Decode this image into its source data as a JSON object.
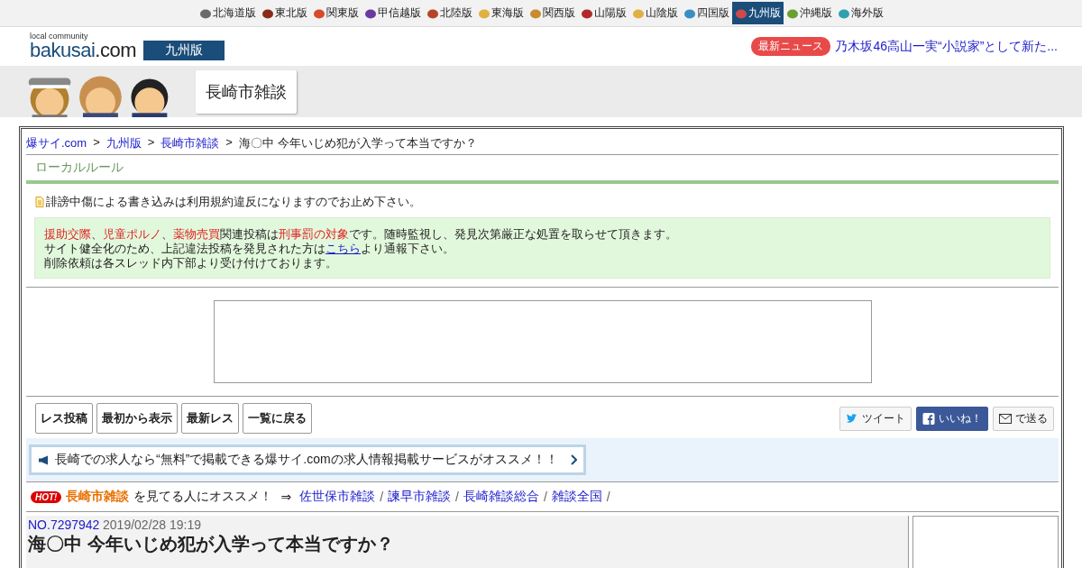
{
  "regions": [
    {
      "label": "北海道版",
      "selected": false,
      "color": "#6a6a6a"
    },
    {
      "label": "東北版",
      "selected": false,
      "color": "#8a2b1a"
    },
    {
      "label": "関東版",
      "selected": false,
      "color": "#d94a2a"
    },
    {
      "label": "甲信越版",
      "selected": false,
      "color": "#6b3aa0"
    },
    {
      "label": "北陸版",
      "selected": false,
      "color": "#b5452a"
    },
    {
      "label": "東海版",
      "selected": false,
      "color": "#e0b040"
    },
    {
      "label": "関西版",
      "selected": false,
      "color": "#c98a30"
    },
    {
      "label": "山陽版",
      "selected": false,
      "color": "#b02a2a"
    },
    {
      "label": "山陰版",
      "selected": false,
      "color": "#e0b040"
    },
    {
      "label": "四国版",
      "selected": false,
      "color": "#3a8fc0"
    },
    {
      "label": "九州版",
      "selected": true,
      "color": "#d04a4a"
    },
    {
      "label": "沖縄版",
      "selected": false,
      "color": "#6aa030"
    },
    {
      "label": "海外版",
      "selected": false,
      "color": "#30a0b0"
    }
  ],
  "header": {
    "logo_tagline": "local community",
    "logo": "bakusai",
    "logo_suffix": ".com",
    "edition": "九州版",
    "news_badge": "最新ニュース",
    "news_headline": "乃木坂46高山一実“小説家”として新た..."
  },
  "board_title": "長崎市雑談",
  "breadcrumb_separator": ">",
  "link_separator": "/",
  "breadcrumbs": [
    {
      "label": "爆サイ.com",
      "kind": "link"
    },
    {
      "label": "九州版",
      "kind": "link"
    },
    {
      "label": "長崎市雑談",
      "kind": "link"
    },
    {
      "label": "海〇中 今年いじめ犯が入学って本当ですか？",
      "kind": "text"
    }
  ],
  "local_rules": {
    "heading": "ローカルルール",
    "rule": "誹謗中傷による書き込みは利用規約違反になりますのでお止め下さい。",
    "notice_lines": [
      [
        {
          "text": "援助交際",
          "kind": "red"
        },
        {
          "text": "、",
          "kind": "plain"
        },
        {
          "text": "児童ポルノ",
          "kind": "red"
        },
        {
          "text": "、",
          "kind": "plain"
        },
        {
          "text": "薬物売買",
          "kind": "red"
        },
        {
          "text": "関連投稿は",
          "kind": "plain"
        },
        {
          "text": "刑事罰の対象",
          "kind": "red"
        },
        {
          "text": "です。随時監視し、発見次第厳正な処置を取らせて頂きます。",
          "kind": "plain"
        }
      ],
      [
        {
          "text": "サイト健全化のため、上記違法投稿を発見された方は",
          "kind": "plain"
        },
        {
          "text": "こちら",
          "kind": "link"
        },
        {
          "text": "より通報下さい。",
          "kind": "plain"
        }
      ],
      [
        {
          "text": "削除依頼は各スレッド内下部より受け付けております。",
          "kind": "plain"
        }
      ]
    ]
  },
  "actions": [
    "レス投稿",
    "最初から表示",
    "最新レス",
    "一覧に戻る"
  ],
  "share": [
    {
      "label": "ツイート",
      "kind": "twitter"
    },
    {
      "label": "いいね！",
      "kind": "facebook"
    },
    {
      "label": "で送る",
      "kind": "mail"
    }
  ],
  "promo": "長崎での求人なら“無料”で掲載できる爆サイ.comの求人情報掲載サービスがオススメ！！",
  "recommend": {
    "badge": "HOT!",
    "board": "長崎市雑談",
    "text": "を見てる人にオススメ！",
    "arrow": "⇒",
    "links": [
      "佐世保市雑談",
      "諫早市雑談",
      "長崎雑談総合",
      "雑談全国"
    ]
  },
  "post": {
    "number": "NO.7297942",
    "date": "2019/02/28 19:19",
    "title": "海〇中 今年いじめ犯が入学って本当ですか？"
  }
}
